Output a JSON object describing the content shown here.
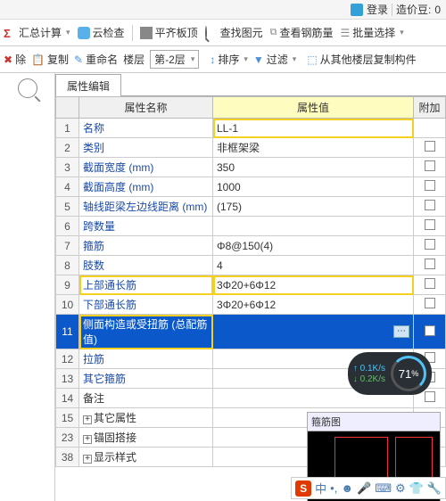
{
  "topbar": {
    "login": "登录",
    "coins_label": "造价豆:",
    "coins": "0"
  },
  "toolbar1": {
    "sum": "汇总计算",
    "cloud": "云检查",
    "flat": "平齐板顶",
    "find": "查找图元",
    "steel": "查看钢筋量",
    "batch": "批量选择"
  },
  "toolbar2": {
    "del": "除",
    "copy": "复制",
    "rename": "重命名",
    "floor_lbl": "楼层",
    "floor_val": "第-2层",
    "sort": "排序",
    "filter": "过滤",
    "copyfloor": "从其他楼层复制构件"
  },
  "tab": "属性编辑",
  "headers": {
    "name": "属性名称",
    "value": "属性值",
    "extra": "附加"
  },
  "rows": [
    {
      "n": "1",
      "name": "名称",
      "val": "LL-1",
      "blue": true,
      "hlval": true
    },
    {
      "n": "2",
      "name": "类别",
      "val": "非框架梁",
      "blue": true,
      "chk": true
    },
    {
      "n": "3",
      "name": "截面宽度 (mm)",
      "val": "350",
      "blue": true,
      "chk": true
    },
    {
      "n": "4",
      "name": "截面高度 (mm)",
      "val": "1000",
      "blue": true,
      "chk": true
    },
    {
      "n": "5",
      "name": "轴线距梁左边线距离 (mm)",
      "val": "(175)",
      "blue": true,
      "chk": true
    },
    {
      "n": "6",
      "name": "跨数量",
      "val": "",
      "blue": true,
      "chk": true
    },
    {
      "n": "7",
      "name": "箍筋",
      "val": "Φ8@150(4)",
      "blue": true,
      "chk": true
    },
    {
      "n": "8",
      "name": "肢数",
      "val": "4",
      "blue": true,
      "chk": true
    },
    {
      "n": "9",
      "name": "上部通长筋",
      "val": "3Φ20+6Φ12",
      "blue": true,
      "chk": true,
      "hlval": true,
      "hlname": true
    },
    {
      "n": "10",
      "name": "下部通长筋",
      "val": "3Φ20+6Φ12",
      "blue": true,
      "chk": true
    },
    {
      "n": "11",
      "name": "侧面构造或受扭筋 (总配筋值)",
      "val": "",
      "blue": true,
      "chk": true,
      "sel": true,
      "hlname": true,
      "btn": true
    },
    {
      "n": "12",
      "name": "拉筋",
      "val": "",
      "blue": true,
      "chk": true
    },
    {
      "n": "13",
      "name": "其它箍筋",
      "val": "",
      "blue": true,
      "chk": true
    },
    {
      "n": "14",
      "name": "备注",
      "val": "",
      "blue": false,
      "chk": true
    },
    {
      "n": "15",
      "name": "其它属性",
      "val": "",
      "blue": false,
      "plus": true
    },
    {
      "n": "23",
      "name": "锚固搭接",
      "val": "",
      "blue": false,
      "plus": true,
      "gray": true
    },
    {
      "n": "38",
      "name": "显示样式",
      "val": "",
      "blue": false,
      "plus": true,
      "gray": true
    }
  ],
  "panel": {
    "title": "箍筋图"
  },
  "widget": {
    "up": "0.1K/s",
    "dn": "0.2K/s",
    "pct": "71",
    "pct_suf": "%"
  },
  "ime": {
    "zhong": "中",
    "items": [
      "✎",
      "●",
      "🎤",
      "⌨",
      "⚙",
      "👕",
      "🔧"
    ]
  }
}
